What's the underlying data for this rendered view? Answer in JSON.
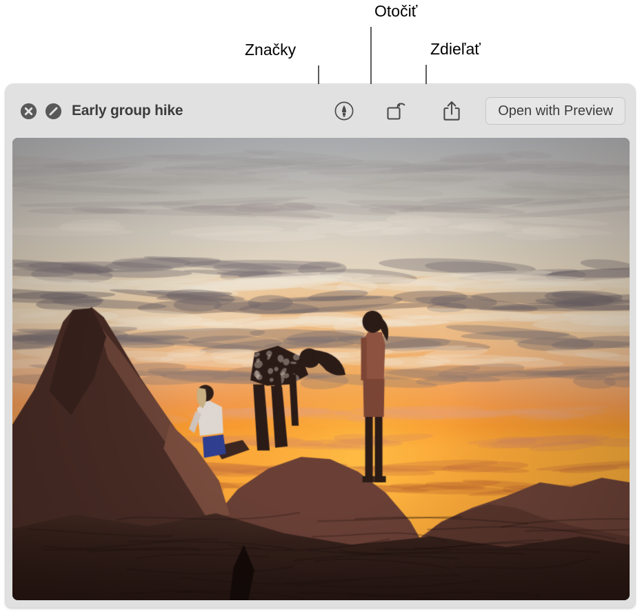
{
  "callouts": [
    {
      "id": "markup",
      "label": "Značky"
    },
    {
      "id": "rotate",
      "label": "Otočiť"
    },
    {
      "id": "share",
      "label": "Zdieľať"
    }
  ],
  "window": {
    "title": "Early group hike",
    "toolbar": {
      "close_icon": "close-circle-x-icon",
      "quicklook_action_icon": "no-entry-slash-circle-icon",
      "markup_icon": "markup-pen-circle-icon",
      "rotate_icon": "rotate-left-square-icon",
      "share_icon": "share-box-up-arrow-icon",
      "open_with_label": "Open with Preview"
    },
    "background": "#e1e1e1",
    "title_color": "#3c3c3c"
  },
  "photo": {
    "name": "sunset-hikers-on-rocks",
    "description": "Three hikers silhouetted on red sandstone rocks against an orange sunset sky",
    "palette": {
      "sky_top": "#b9bcc0",
      "sky_upper_mid": "#d9d2c6",
      "sky_mid": "#e8d7bb",
      "sky_lower": "#eab184",
      "horizon_glow": "#f59a2e",
      "horizon_core": "#fbb03b",
      "cloud_dark": "#8d8486",
      "cloud_light": "#efe5d4",
      "rock_light": "#8a6a5c",
      "rock_mid": "#5d4038",
      "rock_dark": "#3b2620",
      "rock_darkest": "#241511",
      "figure_silhouette": "#2a1b17",
      "figure_shirt_white": "#ded6d0",
      "figure_shorts_blue": "#2f3e8e",
      "figure_clothing_warm": "#a4654a"
    }
  }
}
